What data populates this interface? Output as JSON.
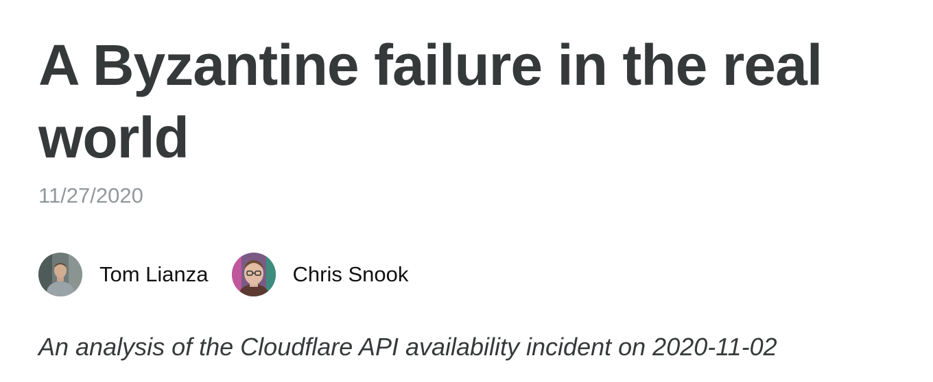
{
  "article": {
    "title": "A Byzantine failure in the real world",
    "date": "11/27/2020",
    "subtitle": "An analysis of the Cloudflare API availability incident on 2020-11-02",
    "authors": [
      {
        "name": "Tom Lianza",
        "avatar_icon": "person-photo-icon"
      },
      {
        "name": "Chris Snook",
        "avatar_icon": "person-photo-icon"
      }
    ]
  }
}
